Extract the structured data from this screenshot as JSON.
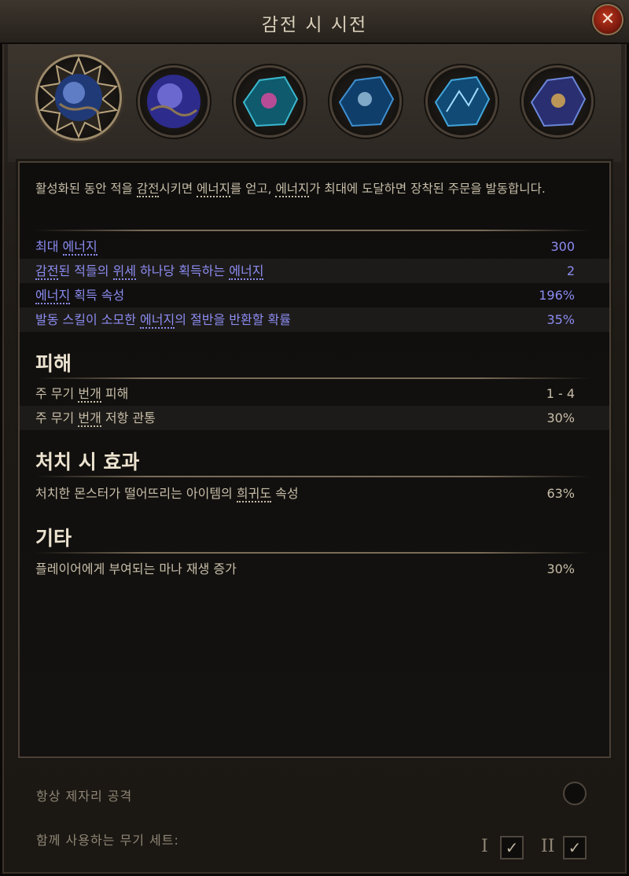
{
  "window": {
    "title": "감전 시 시전",
    "close_label": "✕"
  },
  "gems": [
    {
      "name": "active-gem",
      "color": "#5a7fd0"
    },
    {
      "name": "gem-2",
      "color": "#4a4ac8"
    },
    {
      "name": "gem-3",
      "color": "#37a0b8"
    },
    {
      "name": "gem-4",
      "color": "#2f7cc0"
    },
    {
      "name": "gem-5",
      "color": "#3a8cc8"
    },
    {
      "name": "gem-6",
      "color": "#6a5cc0"
    }
  ],
  "description": {
    "p1": "활성화된 동안 적을 ",
    "k1": "감전",
    "p2": "시키면 ",
    "k2": "에너지",
    "p3": "를 얻고, ",
    "k3": "에너지",
    "p4": "가 최대에 도달하면 장착된 주문을 발동합니다."
  },
  "stats": [
    {
      "label_pre": "최대 ",
      "label_key": "에너지",
      "label_post": "",
      "value": "300"
    },
    {
      "label_pre": "",
      "label_key": "감전",
      "label_mid": "된 적들의 ",
      "label_key2": "위세",
      "label_mid2": " 하나당 획득하는 ",
      "label_key3": "에너지",
      "value": "2"
    },
    {
      "label_pre": "",
      "label_key": "에너지",
      "label_post": " 획득 속성",
      "value": "196%"
    },
    {
      "label_pre": "발동 스킬이 소모한 ",
      "label_key": "에너지",
      "label_post": "의 절반을 반환할 확률",
      "value": "35%"
    }
  ],
  "sections": {
    "damage": {
      "heading": "피해",
      "rows": [
        {
          "pre": "주 무기 ",
          "key": "번개",
          "post": " 피해",
          "value": "1 - 4"
        },
        {
          "pre": "주 무기 ",
          "key": "번개",
          "post": " 저항 관통",
          "value": "30%"
        }
      ]
    },
    "on_kill": {
      "heading": "처치 시 효과",
      "rows": [
        {
          "pre": "처치한 몬스터가 떨어뜨리는 아이템의 ",
          "key": "희귀도",
          "post": " 속성",
          "value": "63%"
        }
      ]
    },
    "other": {
      "heading": "기타",
      "rows": [
        {
          "pre": "플레이어에게 부여되는 마나 재생 증가",
          "value": "30%"
        }
      ]
    }
  },
  "footer": {
    "always_in_place_label": "항상 제자리 공격",
    "weapon_set_label": "함께 사용하는 무기 세트:",
    "set1_label": "I",
    "set2_label": "II",
    "check": "✓"
  }
}
